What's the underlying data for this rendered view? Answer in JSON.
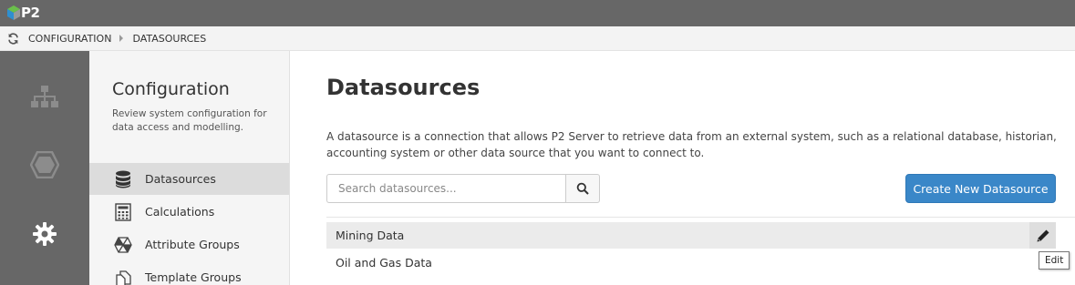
{
  "app": {
    "logo_text": "P2"
  },
  "breadcrumb": {
    "items": [
      "CONFIGURATION",
      "DATASOURCES"
    ]
  },
  "rail": {
    "icons": [
      "hierarchy-icon",
      "hexagon-icon",
      "gear-icon"
    ]
  },
  "panel": {
    "title": "Configuration",
    "description": "Review system configuration for data access and modelling.",
    "items": [
      {
        "label": "Datasources",
        "icon": "database-icon",
        "active": true
      },
      {
        "label": "Calculations",
        "icon": "calculator-icon",
        "active": false
      },
      {
        "label": "Attribute Groups",
        "icon": "attribute-groups-icon",
        "active": false
      },
      {
        "label": "Template Groups",
        "icon": "template-groups-icon",
        "active": false
      }
    ]
  },
  "main": {
    "title": "Datasources",
    "description": "A datasource is a connection that allows P2 Server to retrieve data from an external system, such as a relational database, historian, accounting system or other data source that you want to connect to.",
    "search": {
      "placeholder": "Search datasources...",
      "value": ""
    },
    "create_button_label": "Create New Datasource",
    "rows": [
      {
        "label": "Mining Data",
        "highlighted": true
      },
      {
        "label": "Oil and Gas Data",
        "highlighted": false
      }
    ],
    "tooltip": "Edit"
  },
  "colors": {
    "topbar": "#676767",
    "accent": "#3a87c8",
    "logo_green": "#6abf4b",
    "logo_blue": "#2f8fd0"
  }
}
